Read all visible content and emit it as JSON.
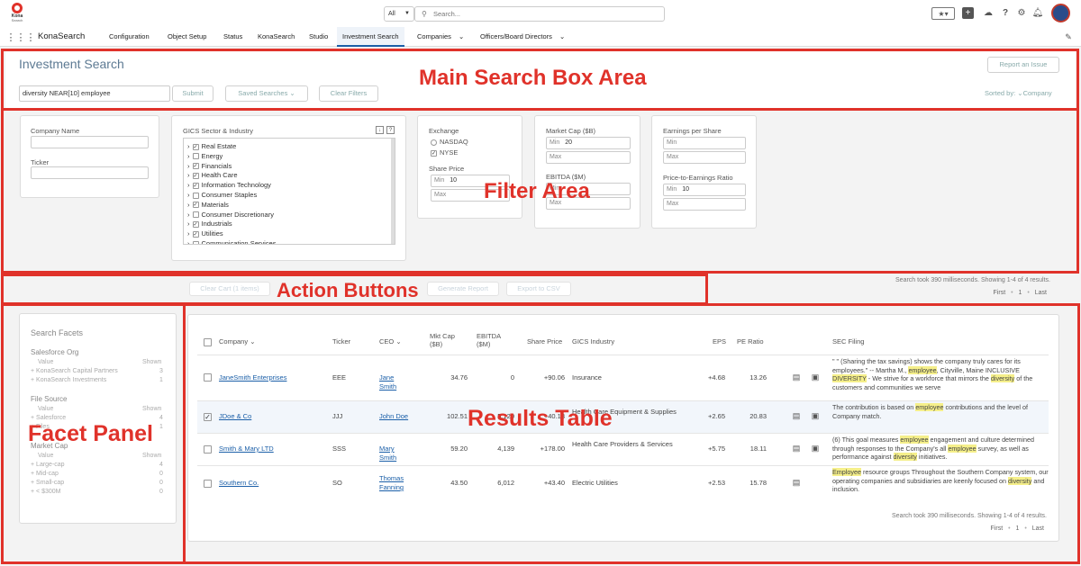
{
  "topbar": {
    "logo_text": "Kona",
    "logo_sub": "Search",
    "scope": "All",
    "search_placeholder": "Search..."
  },
  "nav": {
    "app_name": "KonaSearch",
    "items": [
      "Configuration",
      "Object Setup",
      "Status",
      "KonaSearch",
      "Studio",
      "Investment Search",
      "Companies",
      "Officers/Board Directors"
    ]
  },
  "search": {
    "title": "Investment Search",
    "query": "diversity NEAR[10] employee",
    "submit": "Submit",
    "saved": "Saved Searches",
    "clear": "Clear Filters",
    "report_issue": "Report an Issue",
    "sorted_label": "Sorted by:",
    "sorted_value": "Company"
  },
  "filters": {
    "company_name": "Company Name",
    "ticker": "Ticker",
    "gics_title": "GICS Sector & Industry",
    "gics": [
      {
        "label": "Real Estate",
        "checked": true
      },
      {
        "label": "Energy",
        "checked": false
      },
      {
        "label": "Financials",
        "checked": true
      },
      {
        "label": "Health Care",
        "checked": true
      },
      {
        "label": "Information Technology",
        "checked": true
      },
      {
        "label": "Consumer Staples",
        "checked": false
      },
      {
        "label": "Materials",
        "checked": true
      },
      {
        "label": "Consumer Discretionary",
        "checked": false
      },
      {
        "label": "Industrials",
        "checked": true
      },
      {
        "label": "Utilities",
        "checked": true
      },
      {
        "label": "Communication Services",
        "checked": false
      }
    ],
    "exchange": "Exchange",
    "nasdaq": "NASDAQ",
    "nyse": "NYSE",
    "share_price": "Share Price",
    "min": "Min",
    "max": "Max",
    "share_min": "10",
    "mktcap": "Market Cap ($B)",
    "mktcap_min": "20",
    "ebitda": "EBITDA ($M)",
    "eps": "Earnings per Share",
    "pe": "Price-to-Earnings Ratio",
    "pe_min": "10"
  },
  "actions": {
    "clear_cart": "Clear Cart (1 items)",
    "generate": "Generate Report",
    "export": "Export to CSV",
    "status": "Search took 390 milliseconds. Showing 1-4 of 4 results.",
    "first": "First",
    "page": "1",
    "last": "Last"
  },
  "facets": {
    "title": "Search Facets",
    "groups": [
      {
        "name": "Salesforce Org",
        "value": "Value",
        "shown": "Shown",
        "rows": [
          {
            "l": "KonaSearch Capital Partners",
            "n": "3"
          },
          {
            "l": "KonaSearch Investments",
            "n": "1"
          }
        ]
      },
      {
        "name": "File Source",
        "value": "Value",
        "shown": "Shown",
        "rows": [
          {
            "l": "Salesforce",
            "n": "4"
          },
          {
            "l": "Files",
            "n": "1"
          }
        ]
      },
      {
        "name": "Market Cap",
        "value": "Value",
        "shown": "Shown",
        "rows": [
          {
            "l": "Large-cap",
            "n": "4"
          },
          {
            "l": "Mid-cap",
            "n": "0"
          },
          {
            "l": "Small-cap",
            "n": "0"
          },
          {
            "l": "< $300M",
            "n": "0"
          }
        ]
      }
    ]
  },
  "table": {
    "headers": {
      "company": "Company",
      "ticker": "Ticker",
      "ceo": "CEO",
      "mktcap": "Mkt Cap ($B)",
      "ebitda": "EBITDA ($M)",
      "price": "Share Price",
      "gics": "GICS Industry",
      "eps": "EPS",
      "pe": "PE Ratio",
      "sec": "SEC Filing"
    },
    "rows": [
      {
        "company": "JaneSmith Enterprises",
        "ticker": "EEE",
        "ceo": "Jane Smith",
        "mktcap": "34.76",
        "ebitda": "0",
        "price": "+90.06",
        "gics": "Insurance",
        "eps": "+4.68",
        "pe": "13.26",
        "checked": false
      },
      {
        "company": "JDoe & Co",
        "ticker": "JJJ",
        "ceo": "John Doe",
        "mktcap": "102.51",
        "ebitda": "5,120",
        "price": "+40.13",
        "gics": "Health Care Equipment & Supplies",
        "eps": "+2.65",
        "pe": "20.83",
        "checked": true
      },
      {
        "company": "Smith & Mary LTD",
        "ticker": "SSS",
        "ceo": "Mary Smith",
        "mktcap": "59.20",
        "ebitda": "4,139",
        "price": "+178.00",
        "gics": "Health Care Providers & Services",
        "eps": "+5.75",
        "pe": "18.11",
        "checked": false
      },
      {
        "company": "Southern Co.",
        "ticker": "SO",
        "ceo": "Thomas Fanning",
        "mktcap": "43.50",
        "ebitda": "6,012",
        "price": "+43.40",
        "gics": "Electric Utilities",
        "eps": "+2.53",
        "pe": "15.78",
        "checked": false
      }
    ],
    "filings": [
      [
        "\" \" (Sharing the tax savings) shows the company truly cares for its employees.\" -- Martha M., ",
        "employee",
        ", Cityville, Maine INCLUSIVE ",
        "DIVERSITY",
        " - We strive for a workforce that mirrors the ",
        "diversity",
        " of the customers and communities we serve"
      ],
      [
        "The contribution is based on ",
        "employee",
        " contributions and the level of Company match.",
        "",
        "",
        " ",
        ""
      ],
      [
        "(6) This goal measures ",
        "employee",
        " engagement and culture determined through responses to the Company's all ",
        "employee",
        " survey, as well as performance against ",
        "diversity",
        " initiatives."
      ],
      [
        "",
        "Employee",
        " resource groups Throughout the Southern Company system, our operating companies and subsidiaries are keenly focused on ",
        "diversity",
        " and inclusion.",
        "",
        " "
      ]
    ]
  },
  "overlays": {
    "main": "Main Search Box Area",
    "filter": "Filter Area",
    "actions": "Action Buttons",
    "facet": "Facet Panel",
    "results": "Results Table"
  },
  "colors": {
    "annotation": "#e0322a",
    "link": "#1b5fa8",
    "highlight": "#f5ef8a"
  }
}
